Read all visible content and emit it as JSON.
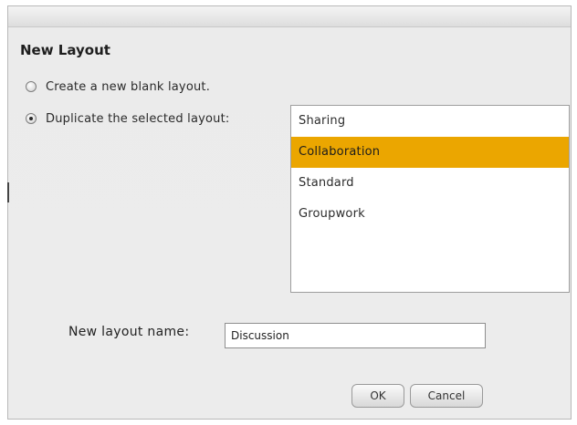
{
  "dialog": {
    "title": "New Layout",
    "options": {
      "blank_label": "Create a new blank layout.",
      "duplicate_label": "Duplicate the selected layout:",
      "selected": "duplicate"
    },
    "layouts": [
      "Sharing",
      "Collaboration",
      "Standard",
      "Groupwork"
    ],
    "selected_layout": "Collaboration",
    "name_field": {
      "label": "New layout name:",
      "value": "Discussion"
    },
    "buttons": {
      "ok": "OK",
      "cancel": "Cancel"
    },
    "colors": {
      "selection": "#eba600"
    }
  }
}
